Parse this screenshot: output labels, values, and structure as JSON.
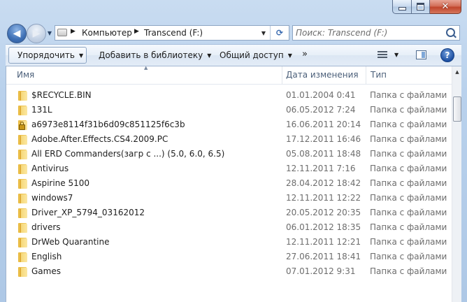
{
  "window": {
    "caption": {
      "minimize": "minimize",
      "maximize": "maximize",
      "close": "✕"
    }
  },
  "nav": {
    "back_glyph": "◀",
    "forward_glyph": "▶",
    "recent_glyph": "▼"
  },
  "address": {
    "separator": "▶",
    "crumbs": [
      "Компьютер",
      "Transcend (F:)"
    ],
    "dropdown_glyph": "▼",
    "refresh_glyph": "⟳"
  },
  "search": {
    "placeholder": "Поиск: Transcend (F:)"
  },
  "toolbar": {
    "organize": "Упорядочить",
    "add_to_library": "Добавить в библиотеку",
    "share": "Общий доступ",
    "more": "»",
    "caret": "▼",
    "help": "?"
  },
  "columns": {
    "name": "Имя",
    "date": "Дата изменения",
    "type": "Тип",
    "sort_glyph": "▲"
  },
  "files": [
    {
      "name": "$RECYCLE.BIN",
      "date": "01.01.2004 0:41",
      "type": "Папка с файлами",
      "locked": false
    },
    {
      "name": "131L",
      "date": "06.05.2012 7:24",
      "type": "Папка с файлами",
      "locked": false
    },
    {
      "name": "a6973e8114f31b6d09c851125f6c3b",
      "date": "16.06.2011 20:14",
      "type": "Папка с файлами",
      "locked": true
    },
    {
      "name": "Adobe.After.Effects.CS4.2009.PC",
      "date": "17.12.2011 16:46",
      "type": "Папка с файлами",
      "locked": false
    },
    {
      "name": "All ERD Commanders(загр с ...) (5.0, 6.0, 6.5)",
      "date": "05.08.2011 18:48",
      "type": "Папка с файлами",
      "locked": false
    },
    {
      "name": "Antivirus",
      "date": "12.11.2011 7:16",
      "type": "Папка с файлами",
      "locked": false
    },
    {
      "name": "Aspirine 5100",
      "date": "28.04.2012 18:42",
      "type": "Папка с файлами",
      "locked": false
    },
    {
      "name": "windows7",
      "date": "12.11.2011 12:22",
      "type": "Папка с файлами",
      "locked": false
    },
    {
      "name": "Driver_XP_5794_03162012",
      "date": "20.05.2012 20:35",
      "type": "Папка с файлами",
      "locked": false
    },
    {
      "name": "drivers",
      "date": "06.01.2012 18:35",
      "type": "Папка с файлами",
      "locked": false
    },
    {
      "name": "DrWeb Quarantine",
      "date": "12.11.2011 12:21",
      "type": "Папка с файлами",
      "locked": false
    },
    {
      "name": "English",
      "date": "27.06.2011 18:41",
      "type": "Папка с файлами",
      "locked": false
    },
    {
      "name": "Games",
      "date": "07.01.2012 9:31",
      "type": "Папка с файлами",
      "locked": false
    }
  ]
}
